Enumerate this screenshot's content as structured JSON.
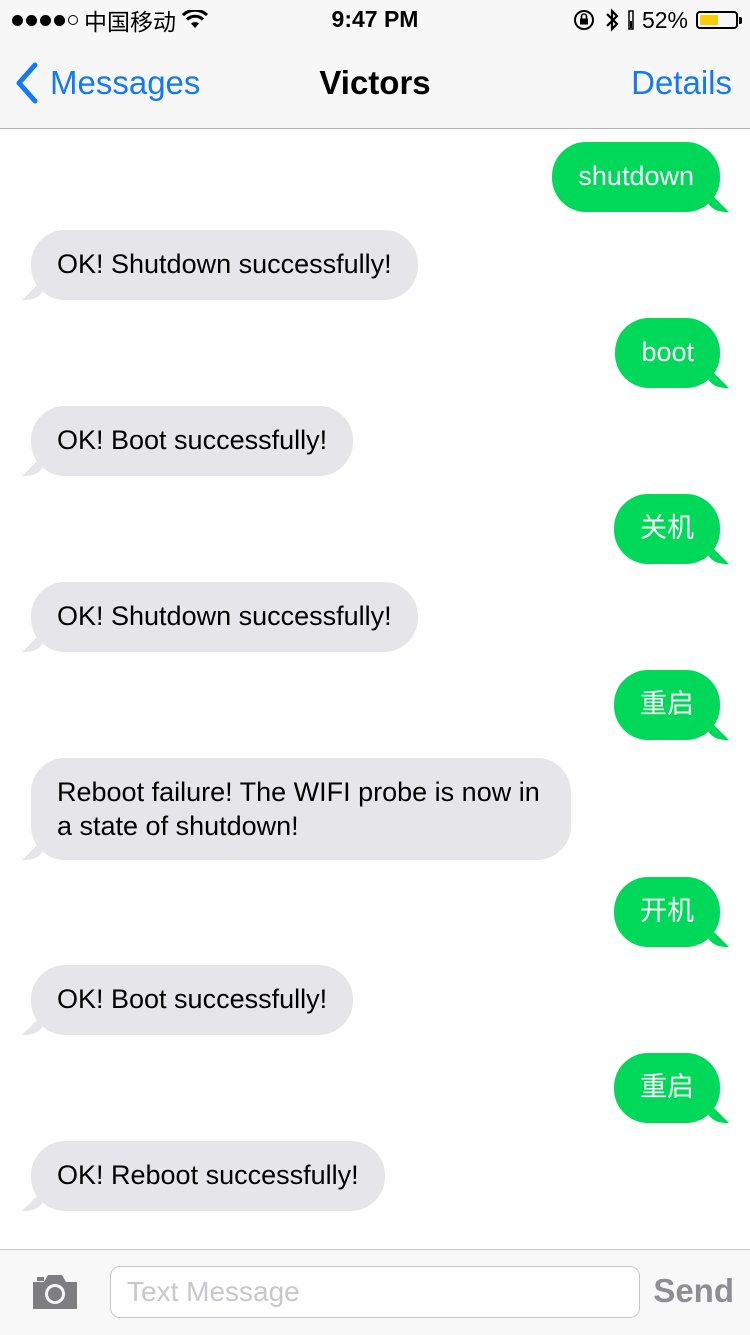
{
  "status_bar": {
    "carrier": "中国移动",
    "time": "9:47 PM",
    "battery_percent_label": "52%",
    "battery_level": 0.52,
    "signal_bars_filled": 4,
    "signal_bars_total": 5
  },
  "nav": {
    "back_label": "Messages",
    "title": "Victors",
    "details_label": "Details",
    "accent_color": "#1479f6"
  },
  "messages": [
    {
      "direction": "outgoing",
      "text": "shutdown"
    },
    {
      "direction": "incoming",
      "text": "OK! Shutdown successfully!"
    },
    {
      "direction": "outgoing",
      "text": "boot"
    },
    {
      "direction": "incoming",
      "text": "OK! Boot successfully!"
    },
    {
      "direction": "outgoing",
      "text": "关机"
    },
    {
      "direction": "incoming",
      "text": "OK! Shutdown successfully!"
    },
    {
      "direction": "outgoing",
      "text": "重启"
    },
    {
      "direction": "incoming",
      "text": "Reboot failure! The WIFI probe is now in a state of shutdown!"
    },
    {
      "direction": "outgoing",
      "text": "开机"
    },
    {
      "direction": "incoming",
      "text": "OK! Boot successfully!"
    },
    {
      "direction": "outgoing",
      "text": "重启"
    },
    {
      "direction": "incoming",
      "text": "OK! Reboot successfully!"
    }
  ],
  "input_bar": {
    "placeholder": "Text Message",
    "value": "",
    "send_label": "Send",
    "camera_icon": "camera-icon"
  },
  "colors": {
    "outgoing_bubble": "#00d859",
    "incoming_bubble": "#e5e5ea",
    "battery_fill": "#ffcc00"
  }
}
